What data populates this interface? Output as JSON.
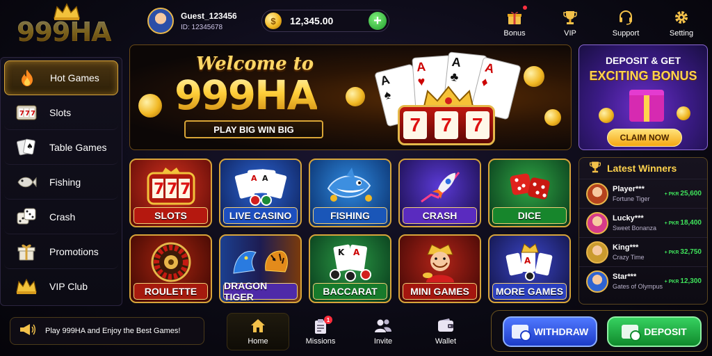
{
  "header": {
    "logo_text": "999HA",
    "user": {
      "name": "Guest_123456",
      "id": "ID: 12345678"
    },
    "balance": "12,345.00",
    "nav": [
      {
        "label": "Bonus",
        "icon": "gift-icon"
      },
      {
        "label": "VIP",
        "icon": "trophy-icon"
      },
      {
        "label": "Support",
        "icon": "headset-icon"
      },
      {
        "label": "Setting",
        "icon": "gear-icon"
      }
    ]
  },
  "sidebar": {
    "items": [
      {
        "label": "Hot Games",
        "icon": "flame-icon",
        "active": true
      },
      {
        "label": "Slots",
        "icon": "slot-machine-icon"
      },
      {
        "label": "Table Games",
        "icon": "playing-cards-icon"
      },
      {
        "label": "Fishing",
        "icon": "fish-icon"
      },
      {
        "label": "Crash",
        "icon": "dice-icon"
      },
      {
        "label": "Promotions",
        "icon": "gift-icon"
      },
      {
        "label": "VIP Club",
        "icon": "crown-icon"
      }
    ]
  },
  "hero": {
    "welcome": "Welcome to",
    "brand": "999HA",
    "tagline": "PLAY BIG  WIN BIG",
    "slot_symbols": [
      "7",
      "7",
      "7"
    ]
  },
  "bonus_panel": {
    "line1": "DEPOSIT & GET",
    "line2": "EXCITING BONUS",
    "cta": "CLAIM NOW"
  },
  "games": [
    {
      "label": "SLOTS",
      "icon": "slot-machine-icon",
      "bg": "#8a1410",
      "label_bg": "#b5180f"
    },
    {
      "label": "LIVE CASINO",
      "icon": "playing-cards-icon",
      "bg": "#123a8a",
      "label_bg": "#1d4fc0"
    },
    {
      "label": "FISHING",
      "icon": "shark-icon",
      "bg": "#0d4b8f",
      "label_bg": "#1a56b8"
    },
    {
      "label": "CRASH",
      "icon": "rocket-icon",
      "bg": "#2a1a72",
      "label_bg": "#5a2bbf"
    },
    {
      "label": "DICE",
      "icon": "dice-icon",
      "bg": "#0e5a1c",
      "label_bg": "#17862c"
    },
    {
      "label": "ROULETTE",
      "icon": "roulette-icon",
      "bg": "#6e1208",
      "label_bg": "#a61a0e"
    },
    {
      "label": "DRAGON TIGER",
      "icon": "dragon-icon",
      "bg": "#1d1c52",
      "label_bg": "#4e2aa8"
    },
    {
      "label": "BACCARAT",
      "icon": "playing-cards-icon",
      "bg": "#0c4a1c",
      "label_bg": "#177a2b"
    },
    {
      "label": "MINI GAMES",
      "icon": "fortune-god-icon",
      "bg": "#6e0e0e",
      "label_bg": "#a4160f"
    },
    {
      "label": "MORE GAMES",
      "icon": "crown-icon",
      "bg": "#1b1e6a",
      "label_bg": "#2b3fbf"
    }
  ],
  "winners": {
    "title": "Latest Winners",
    "list": [
      {
        "name": "Player***",
        "game": "Fortune Tiger",
        "currency": "+ PKR",
        "amount": "25,600"
      },
      {
        "name": "Lucky***",
        "game": "Sweet Bonanza",
        "currency": "+ PKR",
        "amount": "18,400"
      },
      {
        "name": "King***",
        "game": "Crazy Time",
        "currency": "+ PKR",
        "amount": "32,750"
      },
      {
        "name": "Star***",
        "game": "Gates of Olympus",
        "currency": "+ PKR",
        "amount": "12,300"
      }
    ]
  },
  "footer": {
    "marquee": "Play 999HA and Enjoy the Best Games!",
    "nav": [
      {
        "label": "Home",
        "icon": "home-icon",
        "active": true
      },
      {
        "label": "Missions",
        "icon": "clipboard-icon",
        "badge": "1"
      },
      {
        "label": "Invite",
        "icon": "users-icon"
      },
      {
        "label": "Wallet",
        "icon": "wallet-icon"
      }
    ],
    "withdraw_label": "WITHDRAW",
    "deposit_label": "DEPOSIT"
  }
}
